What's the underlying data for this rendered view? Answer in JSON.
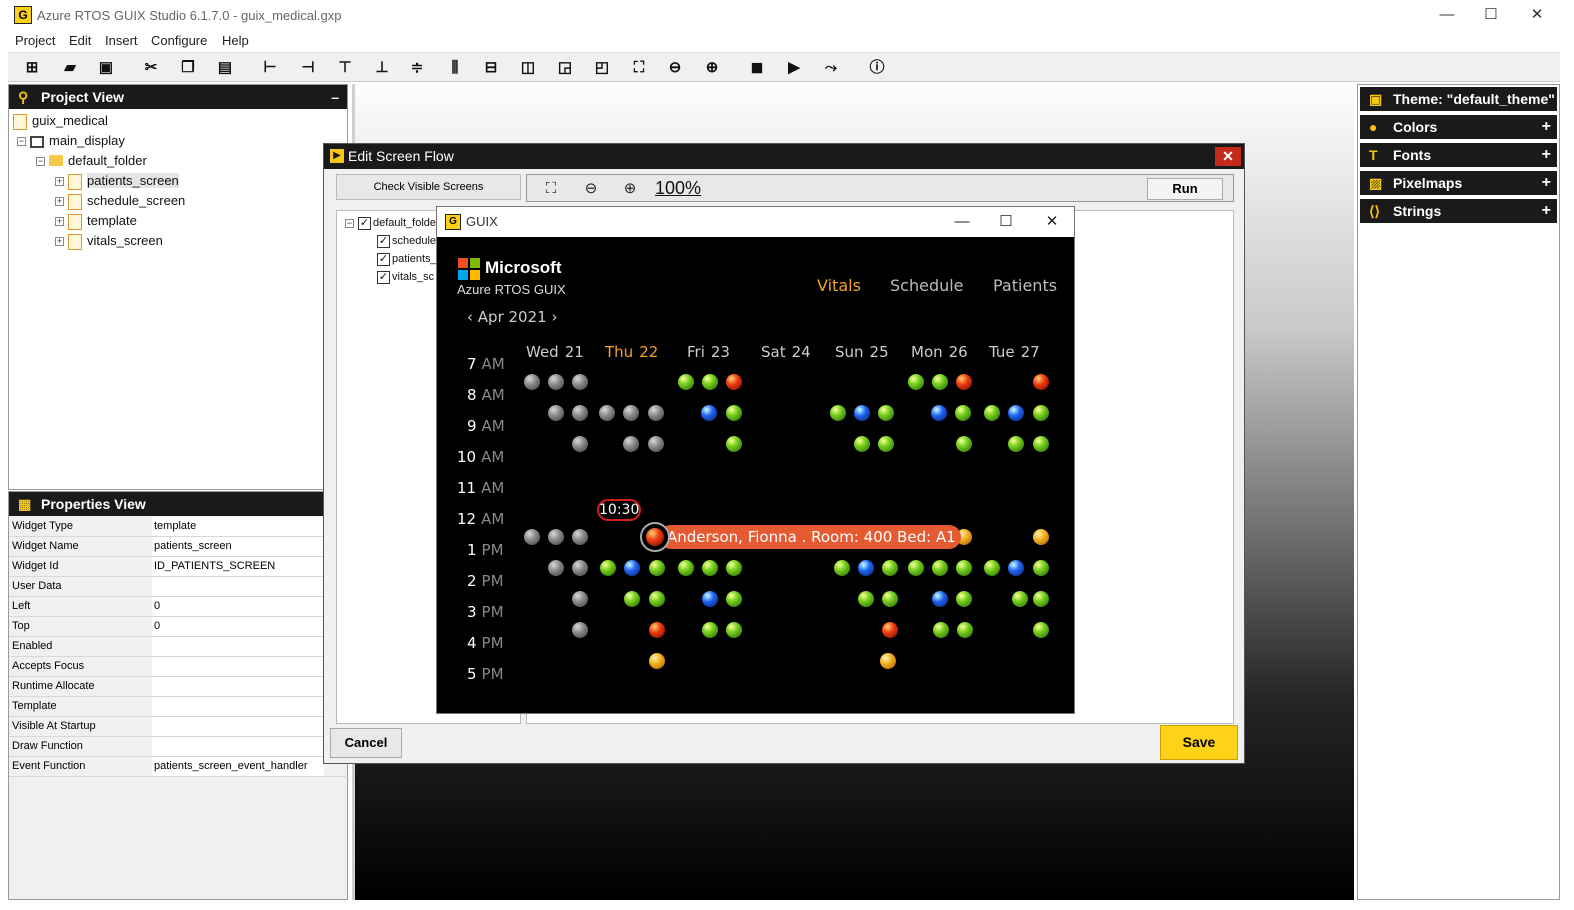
{
  "window": {
    "title": "Azure RTOS GUIX Studio 6.1.7.0 - guix_medical.gxp",
    "app_icon": "G",
    "minimize": "—",
    "maximize": "☐",
    "close": "✕"
  },
  "menu": [
    "Project",
    "Edit",
    "Insert",
    "Configure",
    "Help"
  ],
  "toolbar_icons": [
    "new-icon",
    "open-icon",
    "save-icon",
    "cut-icon",
    "copy-icon",
    "paste-icon",
    "align-left-icon",
    "align-right-icon",
    "align-top-icon",
    "align-bottom-icon",
    "vcenter-icon",
    "hcenter-icon",
    "equal-width-icon",
    "equal-height-icon",
    "move-front-icon",
    "move-back-icon",
    "fit-icon",
    "zoom-out-icon",
    "zoom-in-icon",
    "record-icon",
    "run-icon",
    "runner-icon",
    "help-icon"
  ],
  "project_view": {
    "title": "Project View",
    "minimize": "–",
    "tree": {
      "root": "guix_medical",
      "display": "main_display",
      "folder": "default_folder",
      "screens": [
        "patients_screen",
        "schedule_screen",
        "template",
        "vitals_screen"
      ]
    }
  },
  "properties_view": {
    "title": "Properties View",
    "rows": [
      {
        "name": "Widget Type",
        "value": "template"
      },
      {
        "name": "Widget Name",
        "value": "patients_screen"
      },
      {
        "name": "Widget Id",
        "value": "ID_PATIENTS_SCREEN"
      },
      {
        "name": "User Data",
        "value": ""
      },
      {
        "name": "Left",
        "value": "0"
      },
      {
        "name": "Top",
        "value": "0"
      },
      {
        "name": "Enabled",
        "value": ""
      },
      {
        "name": "Accepts Focus",
        "value": ""
      },
      {
        "name": "Runtime Allocate",
        "value": ""
      },
      {
        "name": "Template",
        "value": ""
      },
      {
        "name": "Visible At Startup",
        "value": ""
      },
      {
        "name": "Draw Function",
        "value": ""
      },
      {
        "name": "Event Function",
        "value": "patients_screen_event_handler"
      }
    ]
  },
  "right_panel": {
    "theme": "Theme: \"default_theme\"",
    "sections": [
      "Colors",
      "Fonts",
      "Pixelmaps",
      "Strings"
    ],
    "plus": "+"
  },
  "dialog": {
    "title": "Edit Screen Flow",
    "close": "✕",
    "check_visible": "Check Visible Screens",
    "zoom": "100%",
    "run": "Run",
    "cancel": "Cancel",
    "save": "Save",
    "tree_folder": "default_folde",
    "tree_items": [
      "schedule",
      "patients_",
      "vitals_sc"
    ],
    "check": "✓"
  },
  "guix": {
    "title": "GUIX",
    "brand": "Microsoft",
    "product": "Azure RTOS GUIX",
    "tabs": [
      "Vitals",
      "Schedule",
      "Patients"
    ],
    "active_tab": "Vitals",
    "active_color": "#f3a420",
    "month": "Apr 2021",
    "days": [
      {
        "day": "Wed",
        "num": "21"
      },
      {
        "day": "Thu",
        "num": "22"
      },
      {
        "day": "Fri",
        "num": "23"
      },
      {
        "day": "Sat",
        "num": "24"
      },
      {
        "day": "Sun",
        "num": "25"
      },
      {
        "day": "Mon",
        "num": "26"
      },
      {
        "day": "Tue",
        "num": "27"
      }
    ],
    "today": "Thu",
    "hours": [
      {
        "h": "7",
        "p": "AM"
      },
      {
        "h": "8",
        "p": "AM"
      },
      {
        "h": "9",
        "p": "AM"
      },
      {
        "h": "10",
        "p": "AM"
      },
      {
        "h": "11",
        "p": "AM"
      },
      {
        "h": "12",
        "p": "AM"
      },
      {
        "h": "1",
        "p": "PM"
      },
      {
        "h": "2",
        "p": "PM"
      },
      {
        "h": "3",
        "p": "PM"
      },
      {
        "h": "4",
        "p": "PM"
      },
      {
        "h": "5",
        "p": "PM"
      }
    ],
    "current_time": "10:30",
    "appointment": "Anderson, Fionna . Room: 400 Bed: A1"
  }
}
